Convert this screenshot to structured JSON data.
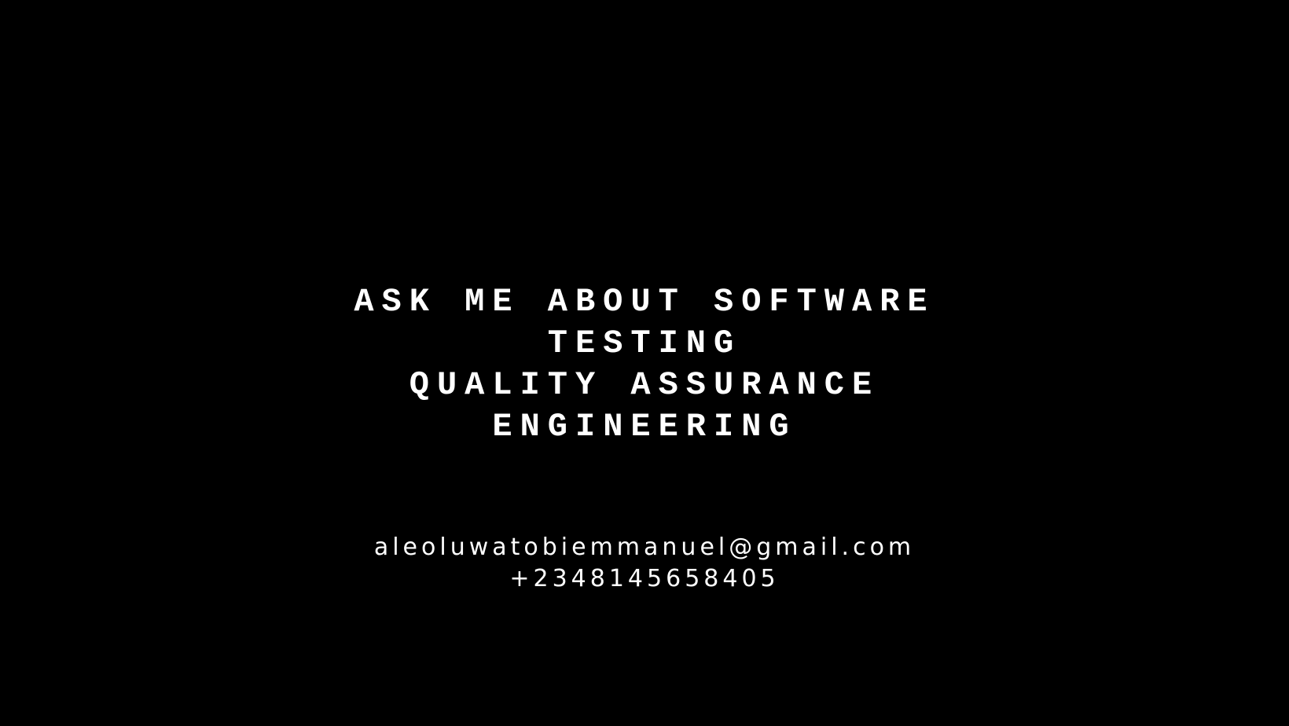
{
  "headline": {
    "lines": [
      "ASK ME ABOUT SOFTWARE",
      "TESTING",
      "QUALITY ASSURANCE",
      "ENGINEERING"
    ]
  },
  "contact": {
    "email": "aleoluwatobiemmanuel@gmail.com",
    "phone": "+2348145658405"
  },
  "colors": {
    "background": "#000000",
    "text": "#ffffff"
  }
}
